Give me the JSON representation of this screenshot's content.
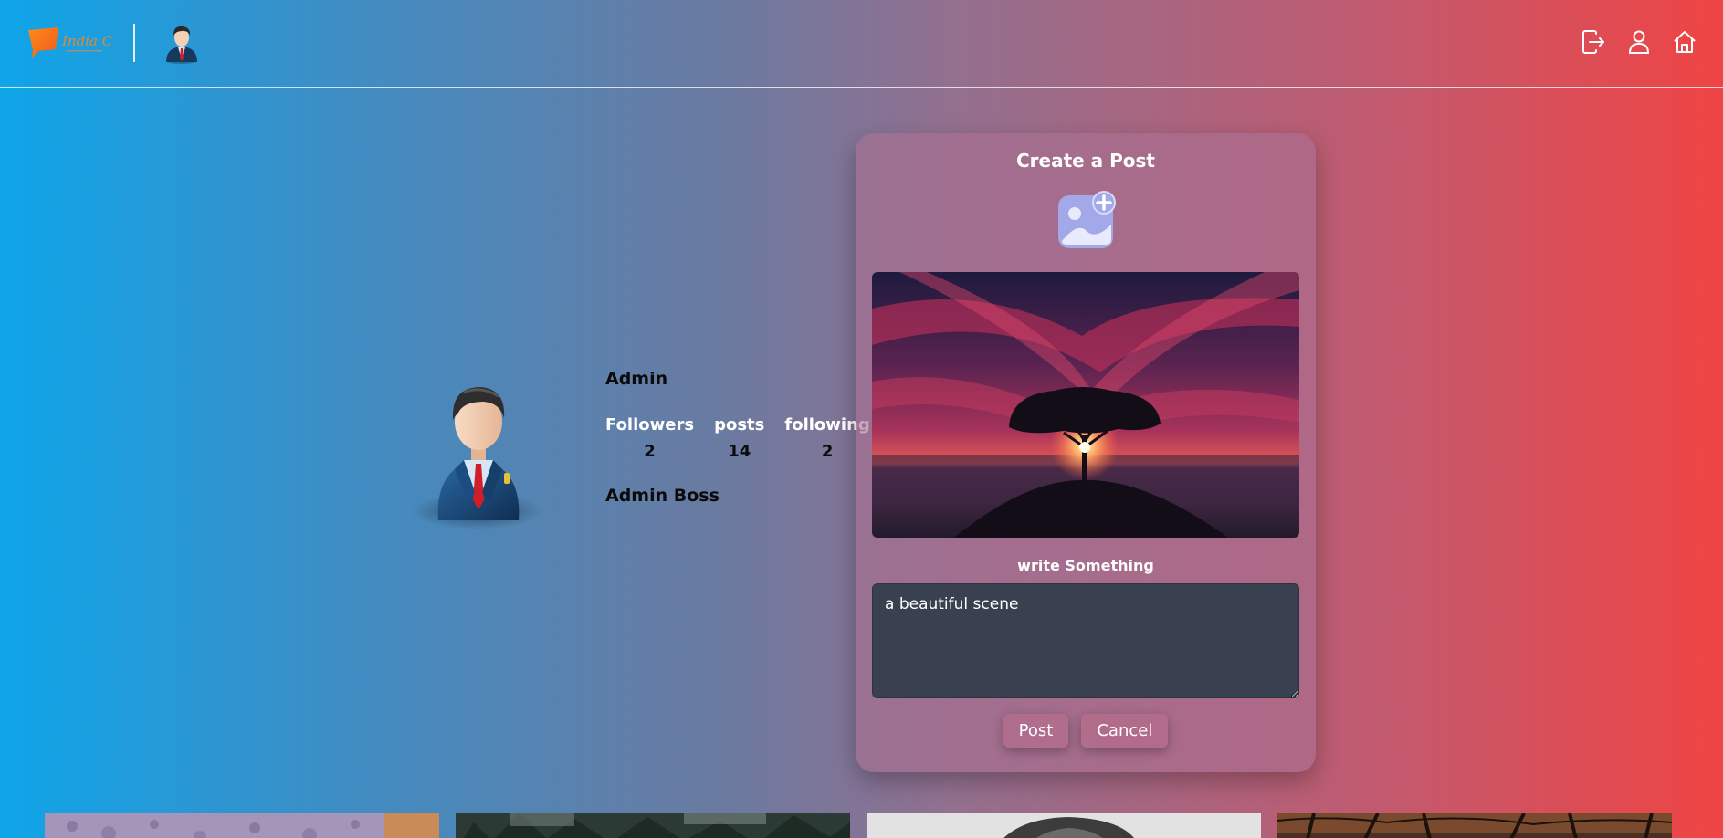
{
  "header": {
    "logo_text": "India C",
    "icons": [
      "logout-icon",
      "profile-icon",
      "home-icon"
    ]
  },
  "profile": {
    "name": "Admin",
    "stats": [
      {
        "label": "Followers",
        "value": "2"
      },
      {
        "label": "posts",
        "value": "14"
      },
      {
        "label": "following",
        "value": "2"
      }
    ],
    "bio": "Admin Boss"
  },
  "create_post": {
    "title": "Create a Post",
    "write_label": "write Something",
    "text_value": "a beautiful scene",
    "post_label": "Post",
    "cancel_label": "Cancel"
  },
  "colors": {
    "gradient_left": "#0ea5e9",
    "gradient_right": "#ef4444",
    "card": "#aa7091",
    "textarea": "#394150"
  }
}
